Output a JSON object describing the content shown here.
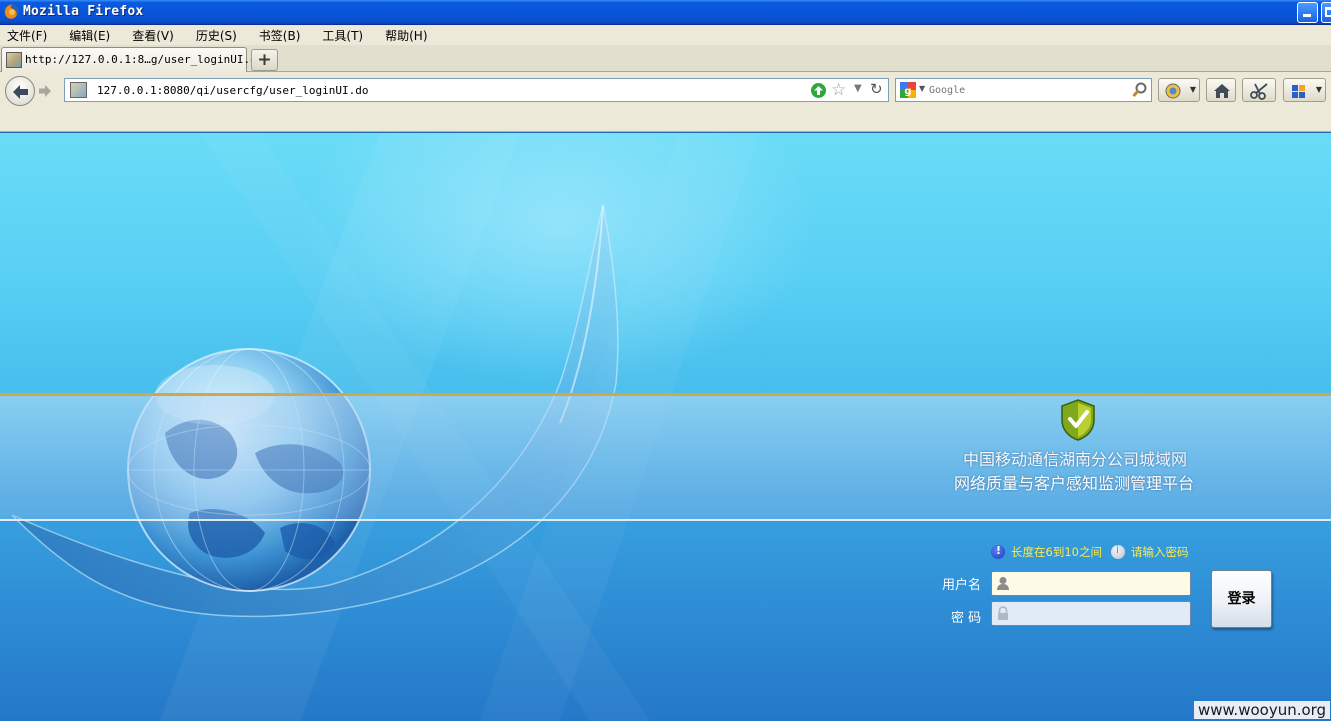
{
  "window": {
    "title": "Mozilla Firefox"
  },
  "menubar": {
    "items": [
      "文件(F)",
      "编辑(E)",
      "查看(V)",
      "历史(S)",
      "书签(B)",
      "工具(T)",
      "帮助(H)"
    ]
  },
  "tabs": [
    {
      "title": "http://127.0.0.1:8…g/user_loginUI.do",
      "active": true
    }
  ],
  "newtab_label": "+",
  "navbar": {
    "url": "127.0.0.1:8080/qi/usercfg/user_loginUI.do",
    "search_placeholder": "Google"
  },
  "page": {
    "brand_line1": "中国移动通信湖南分公司城域网",
    "brand_line2": "网络质量与客户感知监测管理平台",
    "hints": [
      "长度在6到10之间",
      "请输入密码"
    ],
    "username_label": "用户名",
    "password_label": "密  码",
    "login_button": "登录",
    "watermark": "www.wooyun.org"
  },
  "colors": {
    "titlebar": "#0855dd",
    "chrome": "#ece9d8",
    "page_top": "#6adcf7",
    "page_bottom": "#2478c8",
    "band_border": "#d4a64a",
    "hint_text": "#ffe94a"
  },
  "icons": [
    "firefox-icon",
    "back-arrow-icon",
    "forward-arrow-icon",
    "site-favicon",
    "go-icon",
    "star-icon",
    "dropdown-icon",
    "reload-icon",
    "google-icon",
    "search-magnifier-icon",
    "addon-icon",
    "home-icon",
    "scissors-icon",
    "apps-grid-icon",
    "shield-check-icon",
    "info-icon",
    "warning-icon",
    "user-icon",
    "lock-icon"
  ]
}
